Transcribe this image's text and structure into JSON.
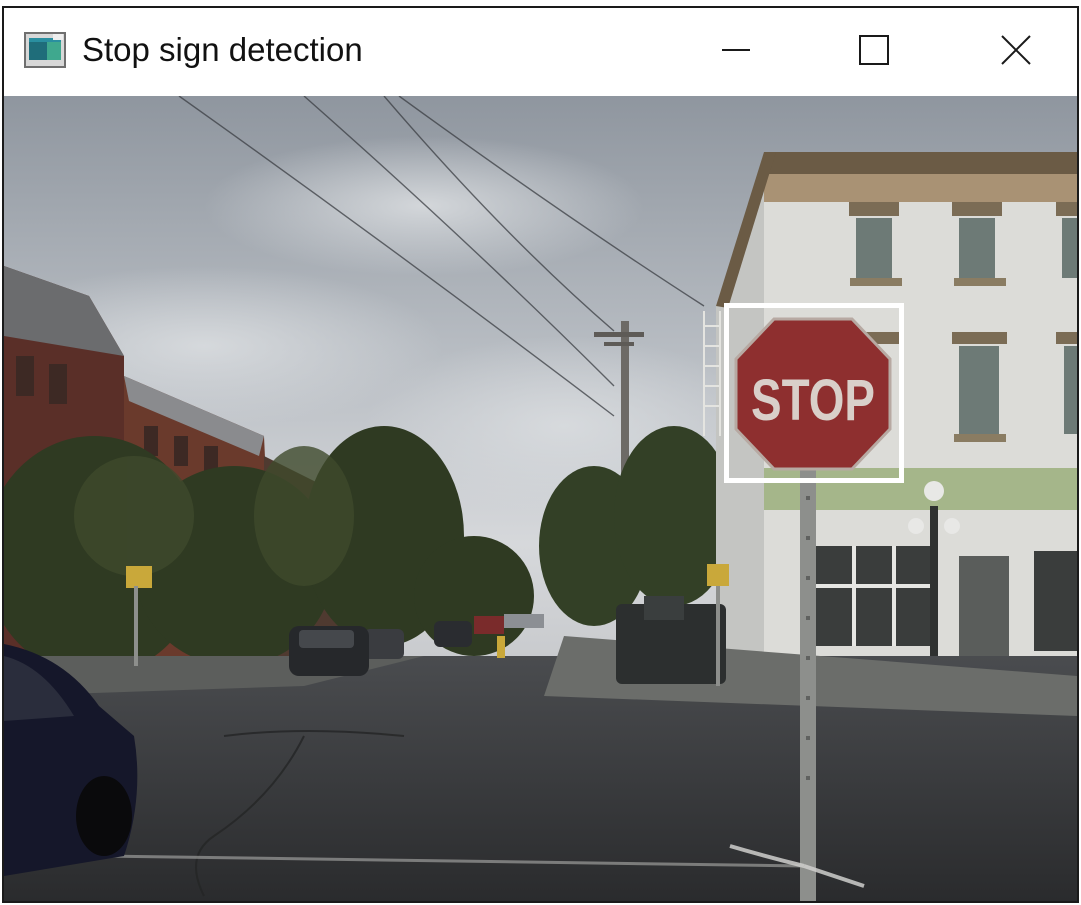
{
  "window": {
    "title": "Stop sign detection",
    "icon": "opencv-window-icon",
    "controls": {
      "minimize": "minimize-icon",
      "maximize": "maximize-icon",
      "close": "close-icon"
    }
  },
  "image": {
    "description_icon": "street-photo",
    "sign_text": "STOP",
    "detection": {
      "label": "stop-sign",
      "color": "#ffffff"
    }
  },
  "colors": {
    "titlebar_bg": "#ffffff",
    "title_text": "#111111",
    "detection_box": "#ffffff",
    "stop_sign_red": "#8e2f2f"
  }
}
